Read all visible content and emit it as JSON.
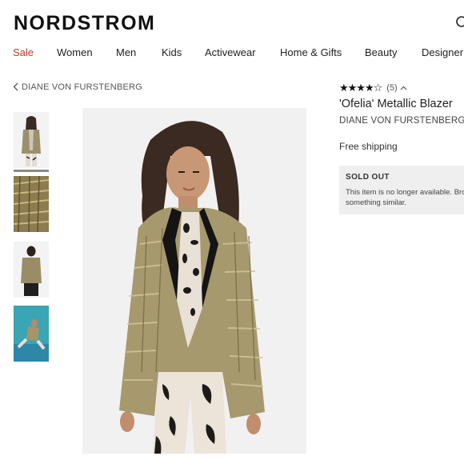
{
  "header": {
    "logo": "NORDSTROM",
    "search_icon": "search-icon"
  },
  "nav": {
    "items": [
      "Sale",
      "Women",
      "Men",
      "Kids",
      "Activewear",
      "Home & Gifts",
      "Beauty",
      "Designer"
    ],
    "sale_color": "#c0392b"
  },
  "breadcrumb": {
    "label": "DIANE VON FURSTENBERG",
    "icon": "chevron-left-icon"
  },
  "gallery": {
    "thumbnails": [
      "front-view",
      "fabric-detail",
      "back-view",
      "editorial-photo"
    ],
    "selected_index": 0
  },
  "product": {
    "rating": 4.5,
    "rating_count": "(5)",
    "title": "'Ofelia' Metallic Blazer",
    "brand": "DIANE VON FURSTENBERG",
    "shipping": "Free shipping",
    "sold_out": {
      "title": "SOLD OUT",
      "message": "This item is no longer available. Browse something similar."
    }
  }
}
